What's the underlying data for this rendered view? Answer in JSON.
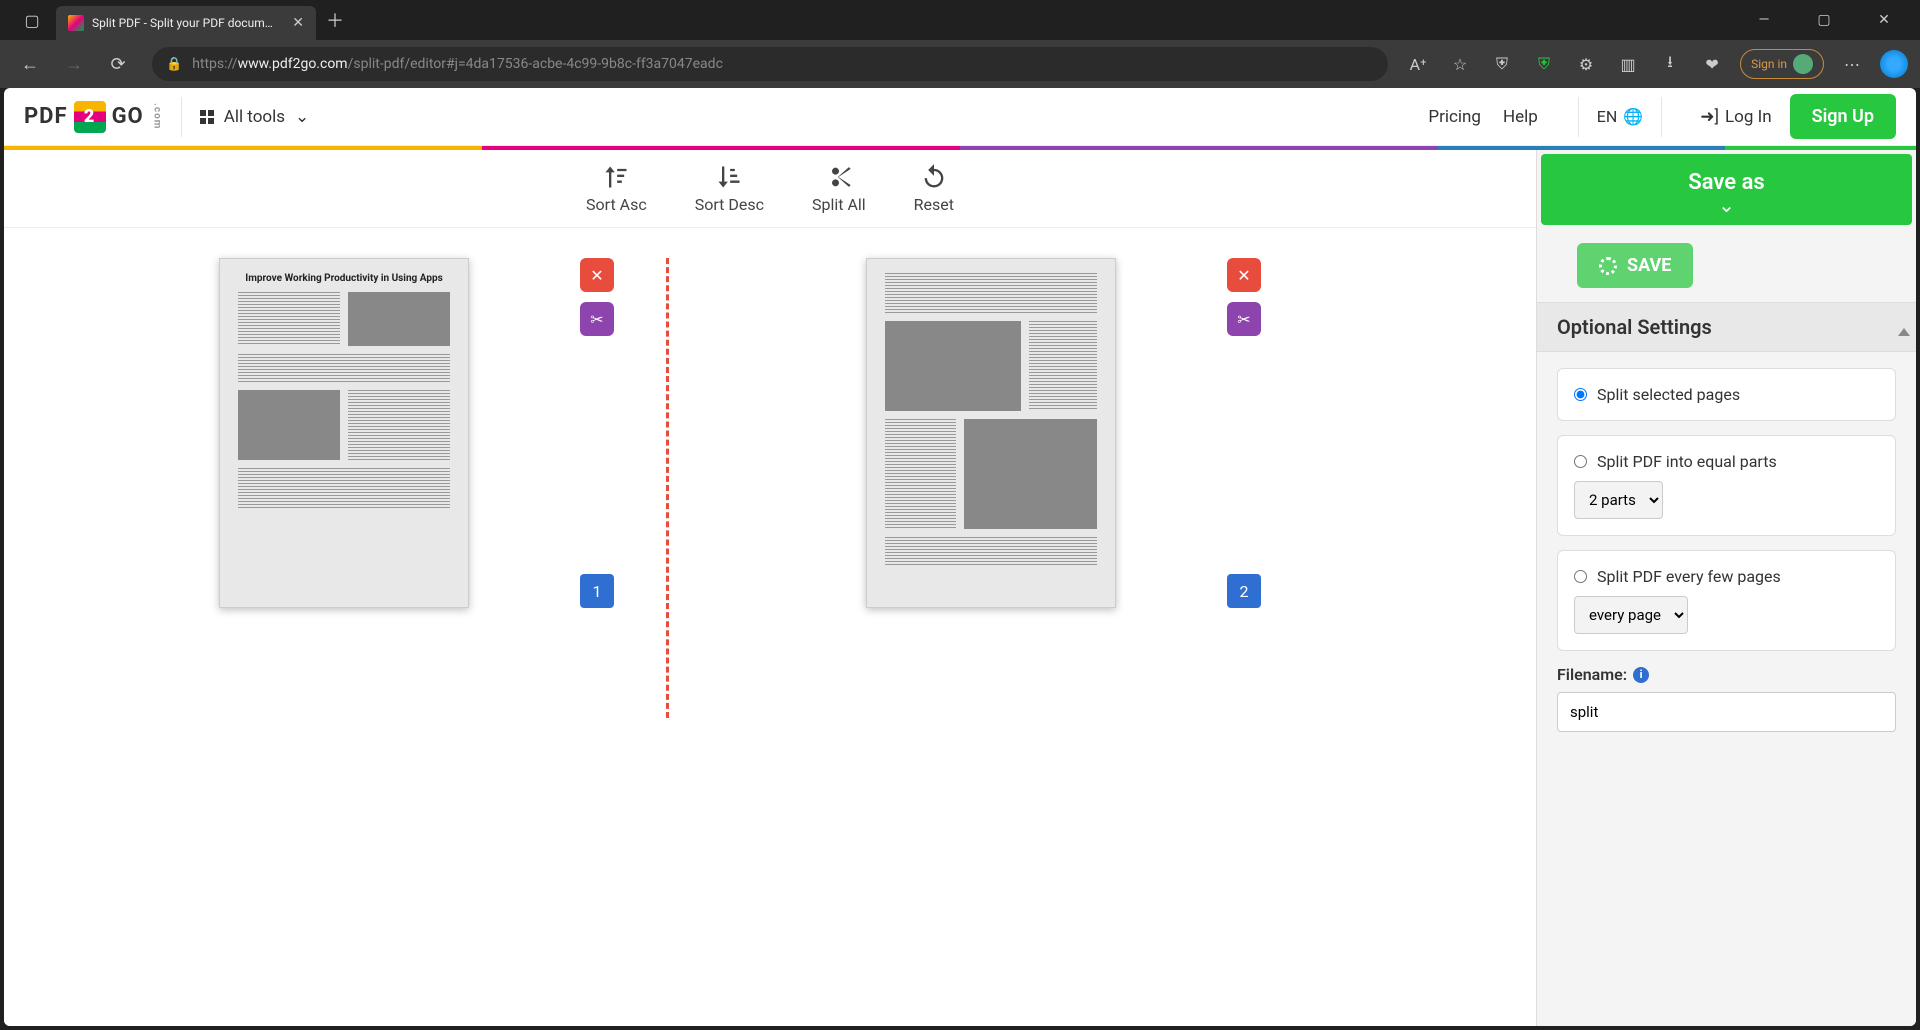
{
  "browser": {
    "tab_title": "Split PDF - Split your PDF docum…",
    "url_prefix": "https://",
    "url_host": "www.pdf2go.com",
    "url_path": "/split-pdf/editor#j=4da17536-acbe-4c99-9b8c-ff3a7047eadc",
    "signin": "Sign in"
  },
  "header": {
    "logo_text": "PDF GO",
    "all_tools": "All tools",
    "pricing": "Pricing",
    "help": "Help",
    "lang": "EN",
    "login": "Log In",
    "signup": "Sign Up"
  },
  "toolbar": {
    "sort_asc": "Sort Asc",
    "sort_desc": "Sort Desc",
    "split_all": "Split All",
    "reset": "Reset"
  },
  "pages": [
    {
      "number": "1",
      "title": "Improve Working Productivity in Using Apps"
    },
    {
      "number": "2",
      "title": ""
    }
  ],
  "side": {
    "save_as": "Save as",
    "save": "SAVE",
    "optional_settings": "Optional Settings",
    "opt_selected": "Split selected pages",
    "opt_equal": "Split PDF into equal parts",
    "parts_value": "2 parts",
    "opt_every": "Split PDF every few pages",
    "every_value": "every page",
    "filename_label": "Filename:",
    "filename_value": "split"
  }
}
